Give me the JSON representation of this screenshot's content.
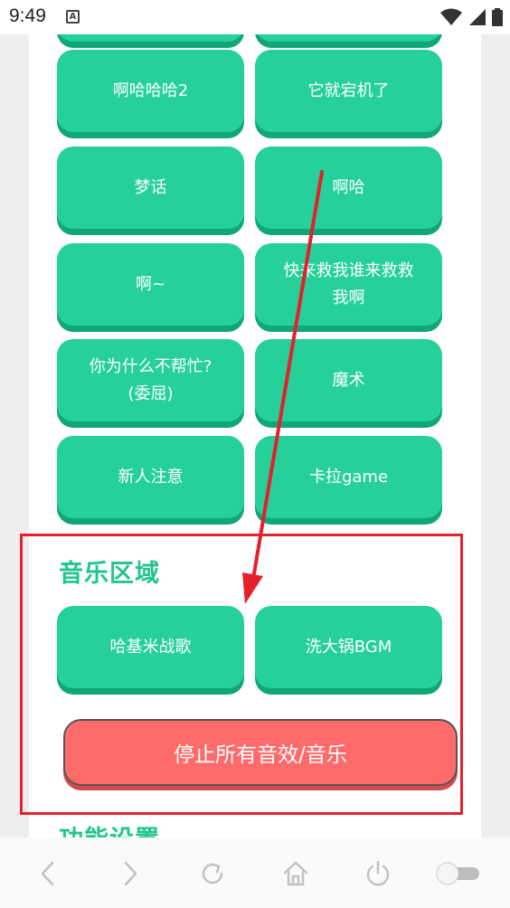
{
  "status_bar": {
    "time": "9:49",
    "notification_icon_label": "A",
    "icons": [
      "wifi-icon",
      "signal-icon",
      "battery-icon"
    ]
  },
  "sound_buttons": [
    {
      "label": ""
    },
    {
      "label": ""
    },
    {
      "label": "啊哈哈哈2"
    },
    {
      "label": "它就宕机了"
    },
    {
      "label": "梦话"
    },
    {
      "label": "啊哈"
    },
    {
      "label": "啊~"
    },
    {
      "label": "快来救我谁来救救\n我啊"
    },
    {
      "label": "你为什么不帮忙?\n(委屈)"
    },
    {
      "label": "魔术"
    },
    {
      "label": "新人注意"
    },
    {
      "label": "卡拉game"
    }
  ],
  "music_section": {
    "title": "音乐区域",
    "buttons": [
      {
        "label": "哈基米战歌"
      },
      {
        "label": "洗大锅BGM"
      }
    ],
    "stop_label": "停止所有音效/音乐"
  },
  "settings_section": {
    "title": "功能设置"
  },
  "annotation": {
    "color": "#e5202b"
  },
  "browser_nav": {
    "icons": [
      "back-icon",
      "forward-icon",
      "refresh-icon",
      "home-icon",
      "power-icon",
      "toggle-icon"
    ]
  },
  "colors": {
    "button": "#26d09b",
    "button_shadow": "#0fa776",
    "title": "#22c58f",
    "stop_button": "#ff6b6b"
  }
}
